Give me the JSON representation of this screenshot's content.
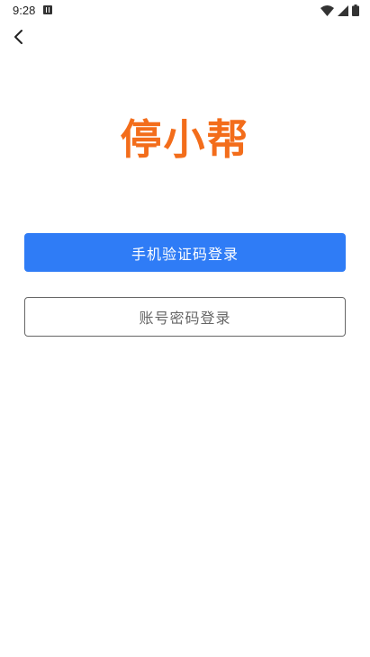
{
  "status_bar": {
    "time": "9:28",
    "notification_icon": "a-notification-icon",
    "wifi_icon": "wifi-icon",
    "signal_icon": "cell-signal-icon",
    "battery_icon": "battery-icon"
  },
  "header": {
    "back_icon": "chevron-left-icon"
  },
  "logo": {
    "text": "停小帮",
    "color": "#f36d1b"
  },
  "login": {
    "sms_login_label": "手机验证码登录",
    "password_login_label": "账号密码登录",
    "primary_color": "#2f7cf6"
  }
}
